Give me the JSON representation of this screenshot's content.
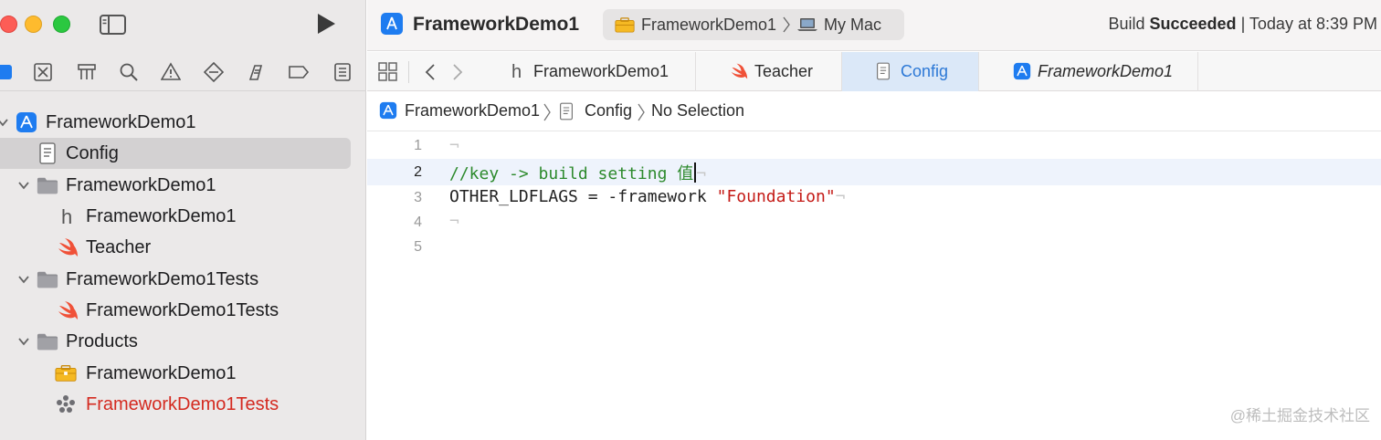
{
  "window": {
    "project_title": "FrameworkDemo1",
    "scheme": "FrameworkDemo1",
    "destination": "My Mac",
    "build_status_prefix": "Build",
    "build_status_bold": "Succeeded",
    "build_status_time": "| Today at 8:39 PM"
  },
  "navigator": {
    "tree": [
      {
        "label": "FrameworkDemo1",
        "icon": "xcode-project-icon"
      },
      {
        "label": "Config",
        "icon": "config-file-icon",
        "selected": true
      },
      {
        "label": "FrameworkDemo1",
        "icon": "folder-icon"
      },
      {
        "label": "FrameworkDemo1",
        "icon": "header-file-icon"
      },
      {
        "label": "Teacher",
        "icon": "swift-icon"
      },
      {
        "label": "FrameworkDemo1Tests",
        "icon": "folder-icon"
      },
      {
        "label": "FrameworkDemo1Tests",
        "icon": "swift-icon"
      },
      {
        "label": "Products",
        "icon": "folder-icon"
      },
      {
        "label": "FrameworkDemo1",
        "icon": "framework-icon"
      },
      {
        "label": "FrameworkDemo1Tests",
        "icon": "test-bundle-icon",
        "color": "#d42a20"
      }
    ]
  },
  "tabs": [
    {
      "label": "FrameworkDemo1",
      "icon": "header-file-icon"
    },
    {
      "label": "Teacher",
      "icon": "swift-icon"
    },
    {
      "label": "Config",
      "icon": "config-file-icon",
      "active": true
    },
    {
      "label": "FrameworkDemo1",
      "icon": "xcode-project-icon",
      "italic": true
    }
  ],
  "jumpbar": {
    "project": "FrameworkDemo1",
    "file": "Config",
    "selection": "No Selection"
  },
  "editor": {
    "line_numbers": [
      "1",
      "2",
      "3",
      "4",
      "5"
    ],
    "current_line": "2",
    "line2_comment": "//key -> build setting 值",
    "line3_key": "OTHER_LDFLAGS = -framework ",
    "line3_string": "\"Foundation\"",
    "invisible_char": "¬"
  },
  "watermark": "@稀土掘金技术社区",
  "colors": {
    "accent": "#1e7cf0",
    "active_tab_bg": "#dbe8f8",
    "active_tab_text": "#2c78d6",
    "swift_orange": "#f05138",
    "comment_green": "#2d8a2d",
    "string_red": "#c41a16",
    "error_red": "#d42a20"
  }
}
